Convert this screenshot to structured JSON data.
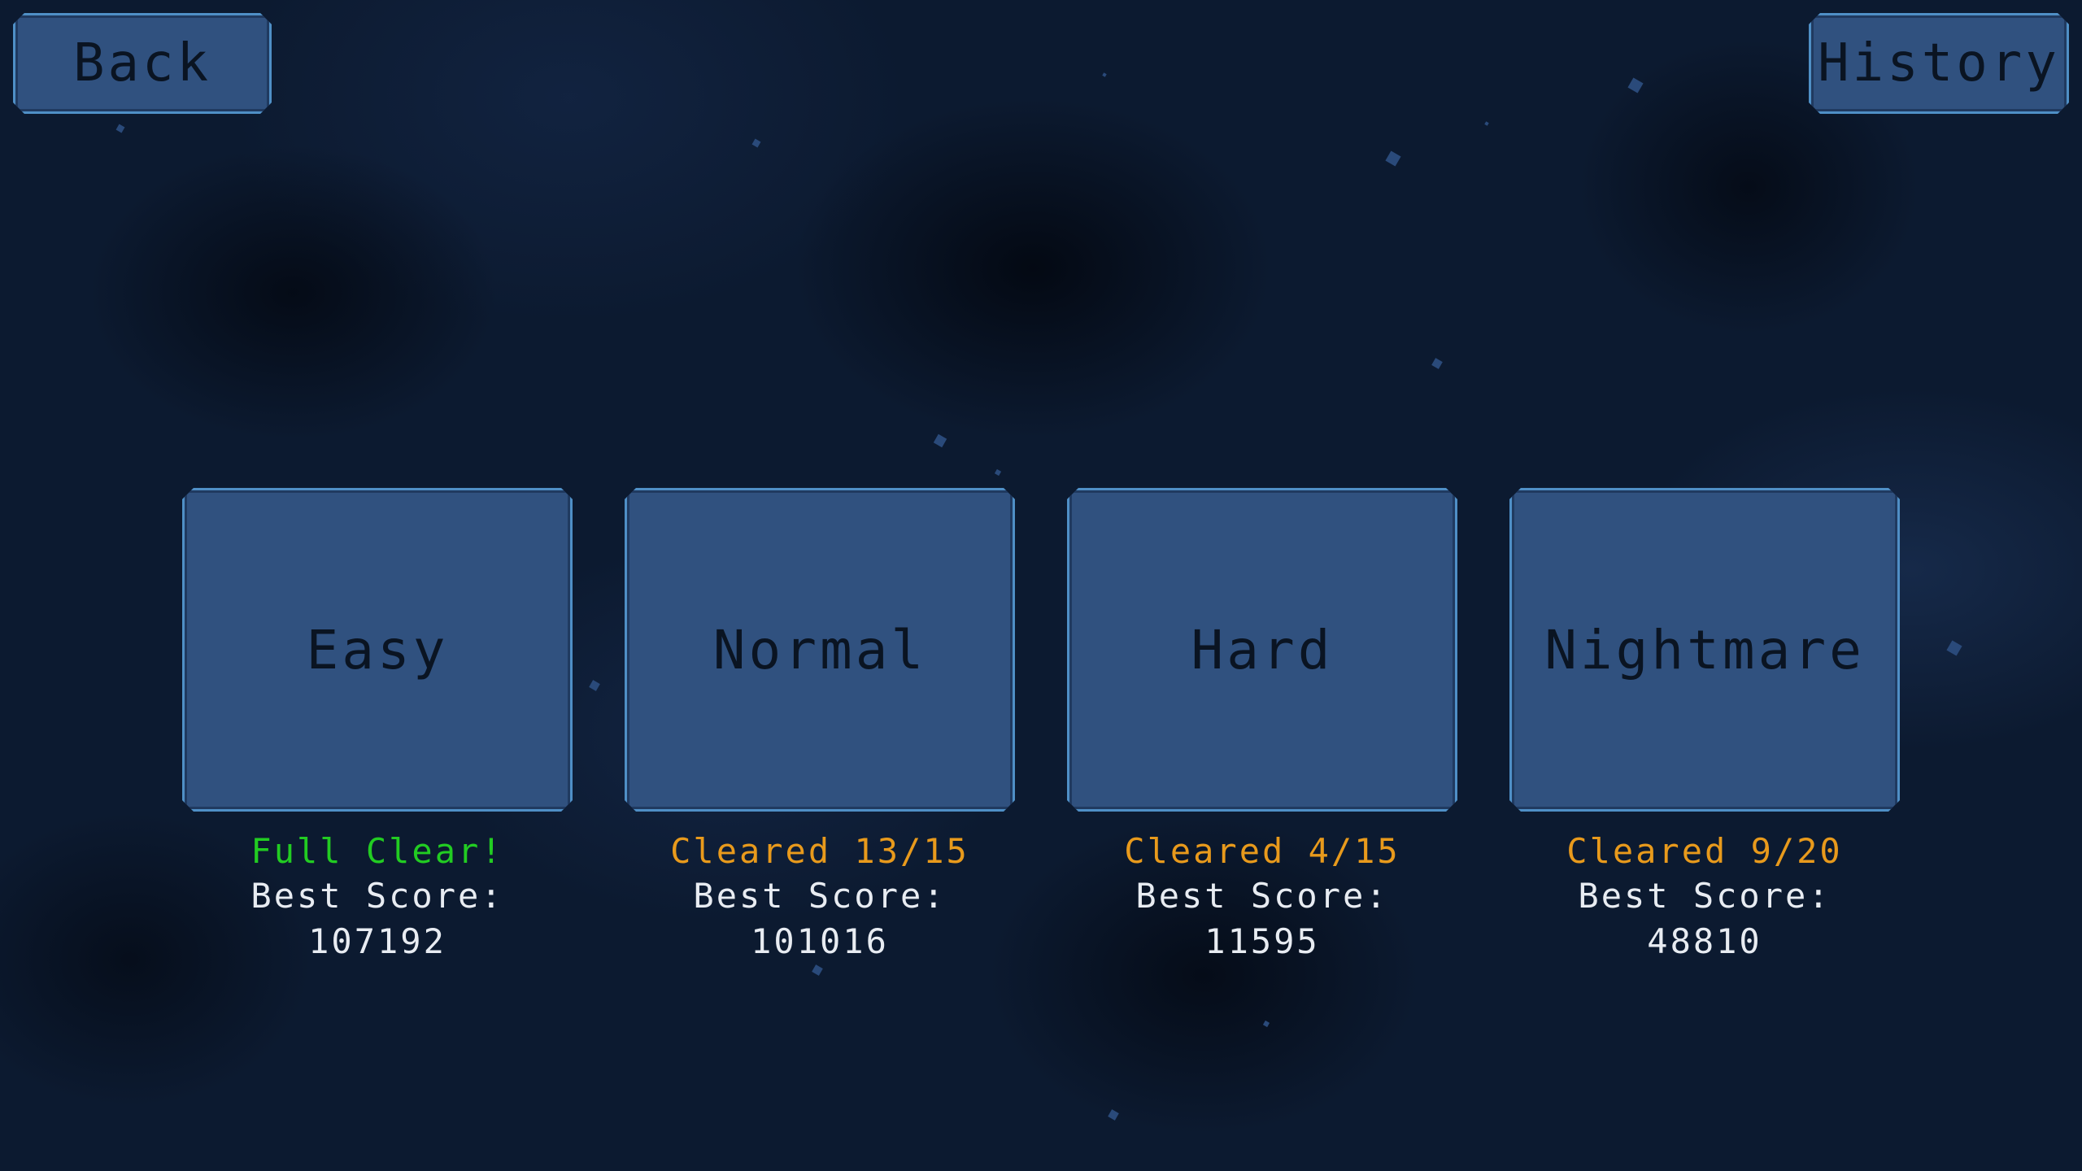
{
  "header": {
    "back_label": "Back",
    "history_label": "History"
  },
  "colors": {
    "full_clear": "#22cc22",
    "partial_clear": "#e89a1c",
    "score_text": "#e8ecf2",
    "card_fill": "#30517f",
    "card_border": "#4f8fc6"
  },
  "difficulties": [
    {
      "label": "Easy",
      "status": "Full Clear!",
      "status_type": "full",
      "score": "Best Score: 107192"
    },
    {
      "label": "Normal",
      "status": "Cleared 13/15",
      "status_type": "partial",
      "score": "Best Score: 101016"
    },
    {
      "label": "Hard",
      "status": "Cleared 4/15",
      "status_type": "partial",
      "score": "Best Score: 11595"
    },
    {
      "label": "Nightmare",
      "status": "Cleared 9/20",
      "status_type": "partial",
      "score": "Best Score: 48810"
    }
  ]
}
